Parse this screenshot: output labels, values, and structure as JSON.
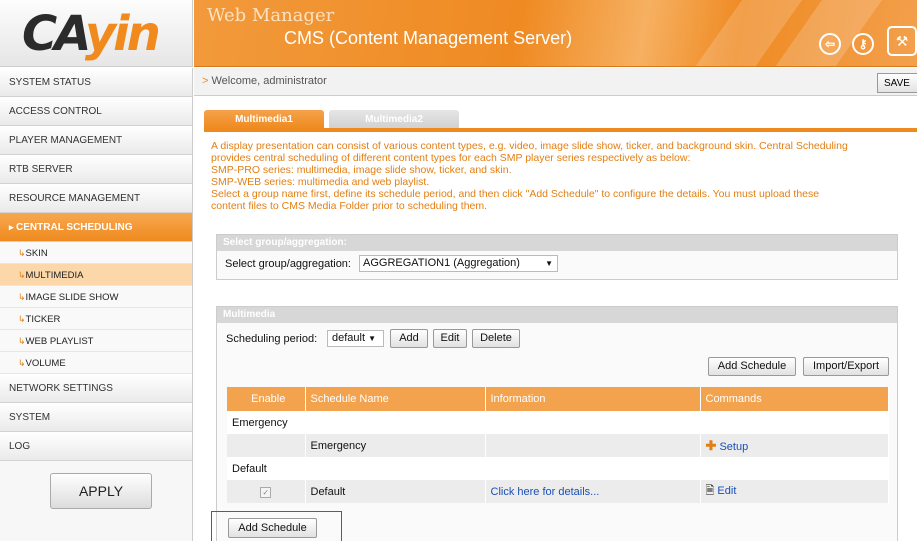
{
  "logo": {
    "text_dark": "CA",
    "text_orange": "yin"
  },
  "header": {
    "app_title": "Web Manager",
    "subtitle": "CMS (Content Management Server)",
    "icons": [
      "logout-icon",
      "key-icon",
      "tools-icon"
    ]
  },
  "sidebar": {
    "items": [
      {
        "label": "SYSTEM STATUS"
      },
      {
        "label": "ACCESS CONTROL"
      },
      {
        "label": "PLAYER MANAGEMENT"
      },
      {
        "label": "RTB SERVER"
      },
      {
        "label": "RESOURCE MANAGEMENT"
      },
      {
        "label": "CENTRAL SCHEDULING",
        "active": true
      },
      {
        "label": "NETWORK SETTINGS"
      },
      {
        "label": "SYSTEM"
      },
      {
        "label": "LOG"
      }
    ],
    "sub_items": [
      {
        "label": "SKIN"
      },
      {
        "label": "MULTIMEDIA",
        "active": true
      },
      {
        "label": "IMAGE SLIDE SHOW"
      },
      {
        "label": "TICKER"
      },
      {
        "label": "WEB PLAYLIST"
      },
      {
        "label": "VOLUME"
      }
    ],
    "apply_label": "APPLY"
  },
  "topbar": {
    "welcome": "Welcome, administrator",
    "save_label": "SAVE"
  },
  "tabs": [
    {
      "label": "Multimedia1",
      "active": true
    },
    {
      "label": "Multimedia2",
      "active": false
    }
  ],
  "description": [
    "A display presentation can consist of various content types, e.g. video, image slide show, ticker, and background skin. Central Scheduling",
    "provides central scheduling of different content types for each SMP player series respectively as below:",
    "SMP-PRO series: multimedia, image slide show, ticker, and skin.",
    "SMP-WEB series: multimedia and web playlist.",
    "Select a group name first, define its schedule period, and then click \"Add Schedule\" to configure the details. You must upload these",
    "content files to CMS Media Folder prior to scheduling them."
  ],
  "group_section": {
    "heading": "Select group/aggregation:",
    "label": "Select group/aggregation:",
    "selected": "AGGREGATION1 (Aggregation)"
  },
  "multimedia_section": {
    "heading": "Multimedia",
    "period_label": "Scheduling period:",
    "period_selected": "default",
    "add_label": "Add",
    "edit_label": "Edit",
    "delete_label": "Delete",
    "add_schedule_label": "Add Schedule",
    "import_export_label": "Import/Export",
    "columns": [
      "Enable",
      "Schedule Name",
      "Information",
      "Commands"
    ],
    "groups": [
      {
        "name": "Emergency",
        "row": {
          "enabled": false,
          "schedule_name": "Emergency",
          "information": "",
          "command": "Setup",
          "command_icon": "plus-icon"
        }
      },
      {
        "name": "Default",
        "row": {
          "enabled": true,
          "schedule_name": "Default",
          "information": "Click here for details...",
          "command": "Edit",
          "command_icon": "document-icon"
        }
      }
    ],
    "bottom_add_schedule_label": "Add Schedule"
  },
  "colors": {
    "accent": "#ee8a1e",
    "link": "#1a4fb8",
    "highlight_box": "#e0252a"
  }
}
